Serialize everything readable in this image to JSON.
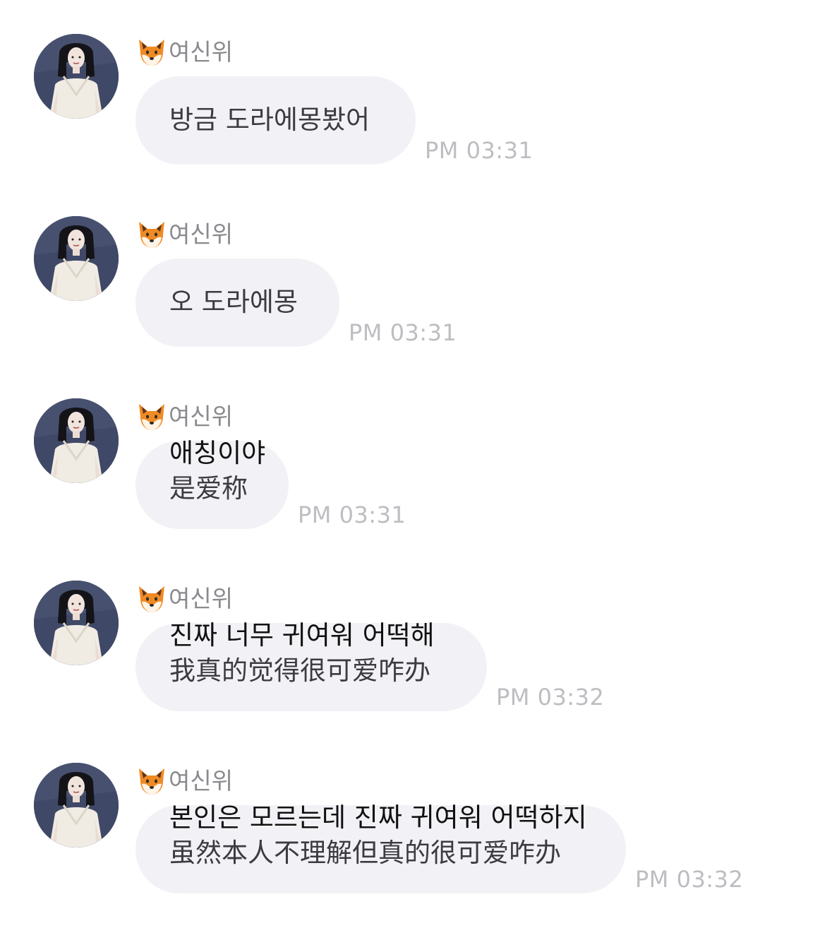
{
  "chat": {
    "messages": [
      {
        "sender": "여신위",
        "sender_icon": "fox-emoji",
        "text": "방금 도라에몽봤어",
        "time": "PM 03:31"
      },
      {
        "sender": "여신위",
        "sender_icon": "fox-emoji",
        "text": "오 도라에몽",
        "time": "PM 03:31"
      },
      {
        "sender": "여신위",
        "sender_icon": "fox-emoji",
        "text": "애칭이야",
        "translation": "是爱称",
        "time": "PM 03:31"
      },
      {
        "sender": "여신위",
        "sender_icon": "fox-emoji",
        "text": "진짜 너무 귀여워 어떡해",
        "translation": "我真的觉得很可爱咋办",
        "time": "PM 03:32"
      },
      {
        "sender": "여신위",
        "sender_icon": "fox-emoji",
        "text": "본인은 모르는데 진짜 귀여워 어떡하지",
        "translation": "虽然本人不理解但真的很可爱咋办",
        "time": "PM 03:32"
      }
    ]
  },
  "colors": {
    "bubble": "#f2f2f6",
    "sender_name": "#8a8a8e",
    "timestamp": "#bdbdc2",
    "text_primary": "#111111",
    "text_secondary": "#3c3c40"
  }
}
